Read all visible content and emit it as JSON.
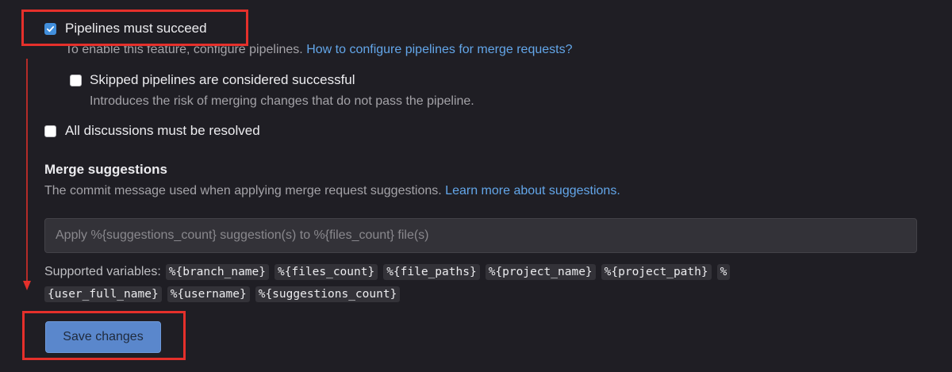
{
  "pipelines": {
    "label": "Pipelines must succeed",
    "checked": true,
    "help_text": "To enable this feature, configure pipelines.",
    "help_link": "How to configure pipelines for merge requests?"
  },
  "skipped": {
    "label": "Skipped pipelines are considered successful",
    "checked": false,
    "help_text": "Introduces the risk of merging changes that do not pass the pipeline."
  },
  "discussions": {
    "label": "All discussions must be resolved",
    "checked": false
  },
  "merge_suggestions": {
    "title": "Merge suggestions",
    "description": "The commit message used when applying merge request suggestions.",
    "link": "Learn more about suggestions.",
    "placeholder": "Apply %{suggestions_count} suggestion(s) to %{files_count} file(s)",
    "value": "",
    "supported_label": "Supported variables:",
    "variables_line1": [
      "%{branch_name}",
      "%{files_count}",
      "%{file_paths}",
      "%{project_name}",
      "%{project_path}",
      "%"
    ],
    "variables_line2": [
      "{user_full_name}",
      "%{username}",
      "%{suggestions_count}"
    ]
  },
  "save_button": {
    "label": "Save changes"
  },
  "colors": {
    "background": "#1f1e24",
    "accent": "#428fdc",
    "link": "#63a6e9",
    "annotation": "#e5302b",
    "button": "#5a87cc"
  }
}
